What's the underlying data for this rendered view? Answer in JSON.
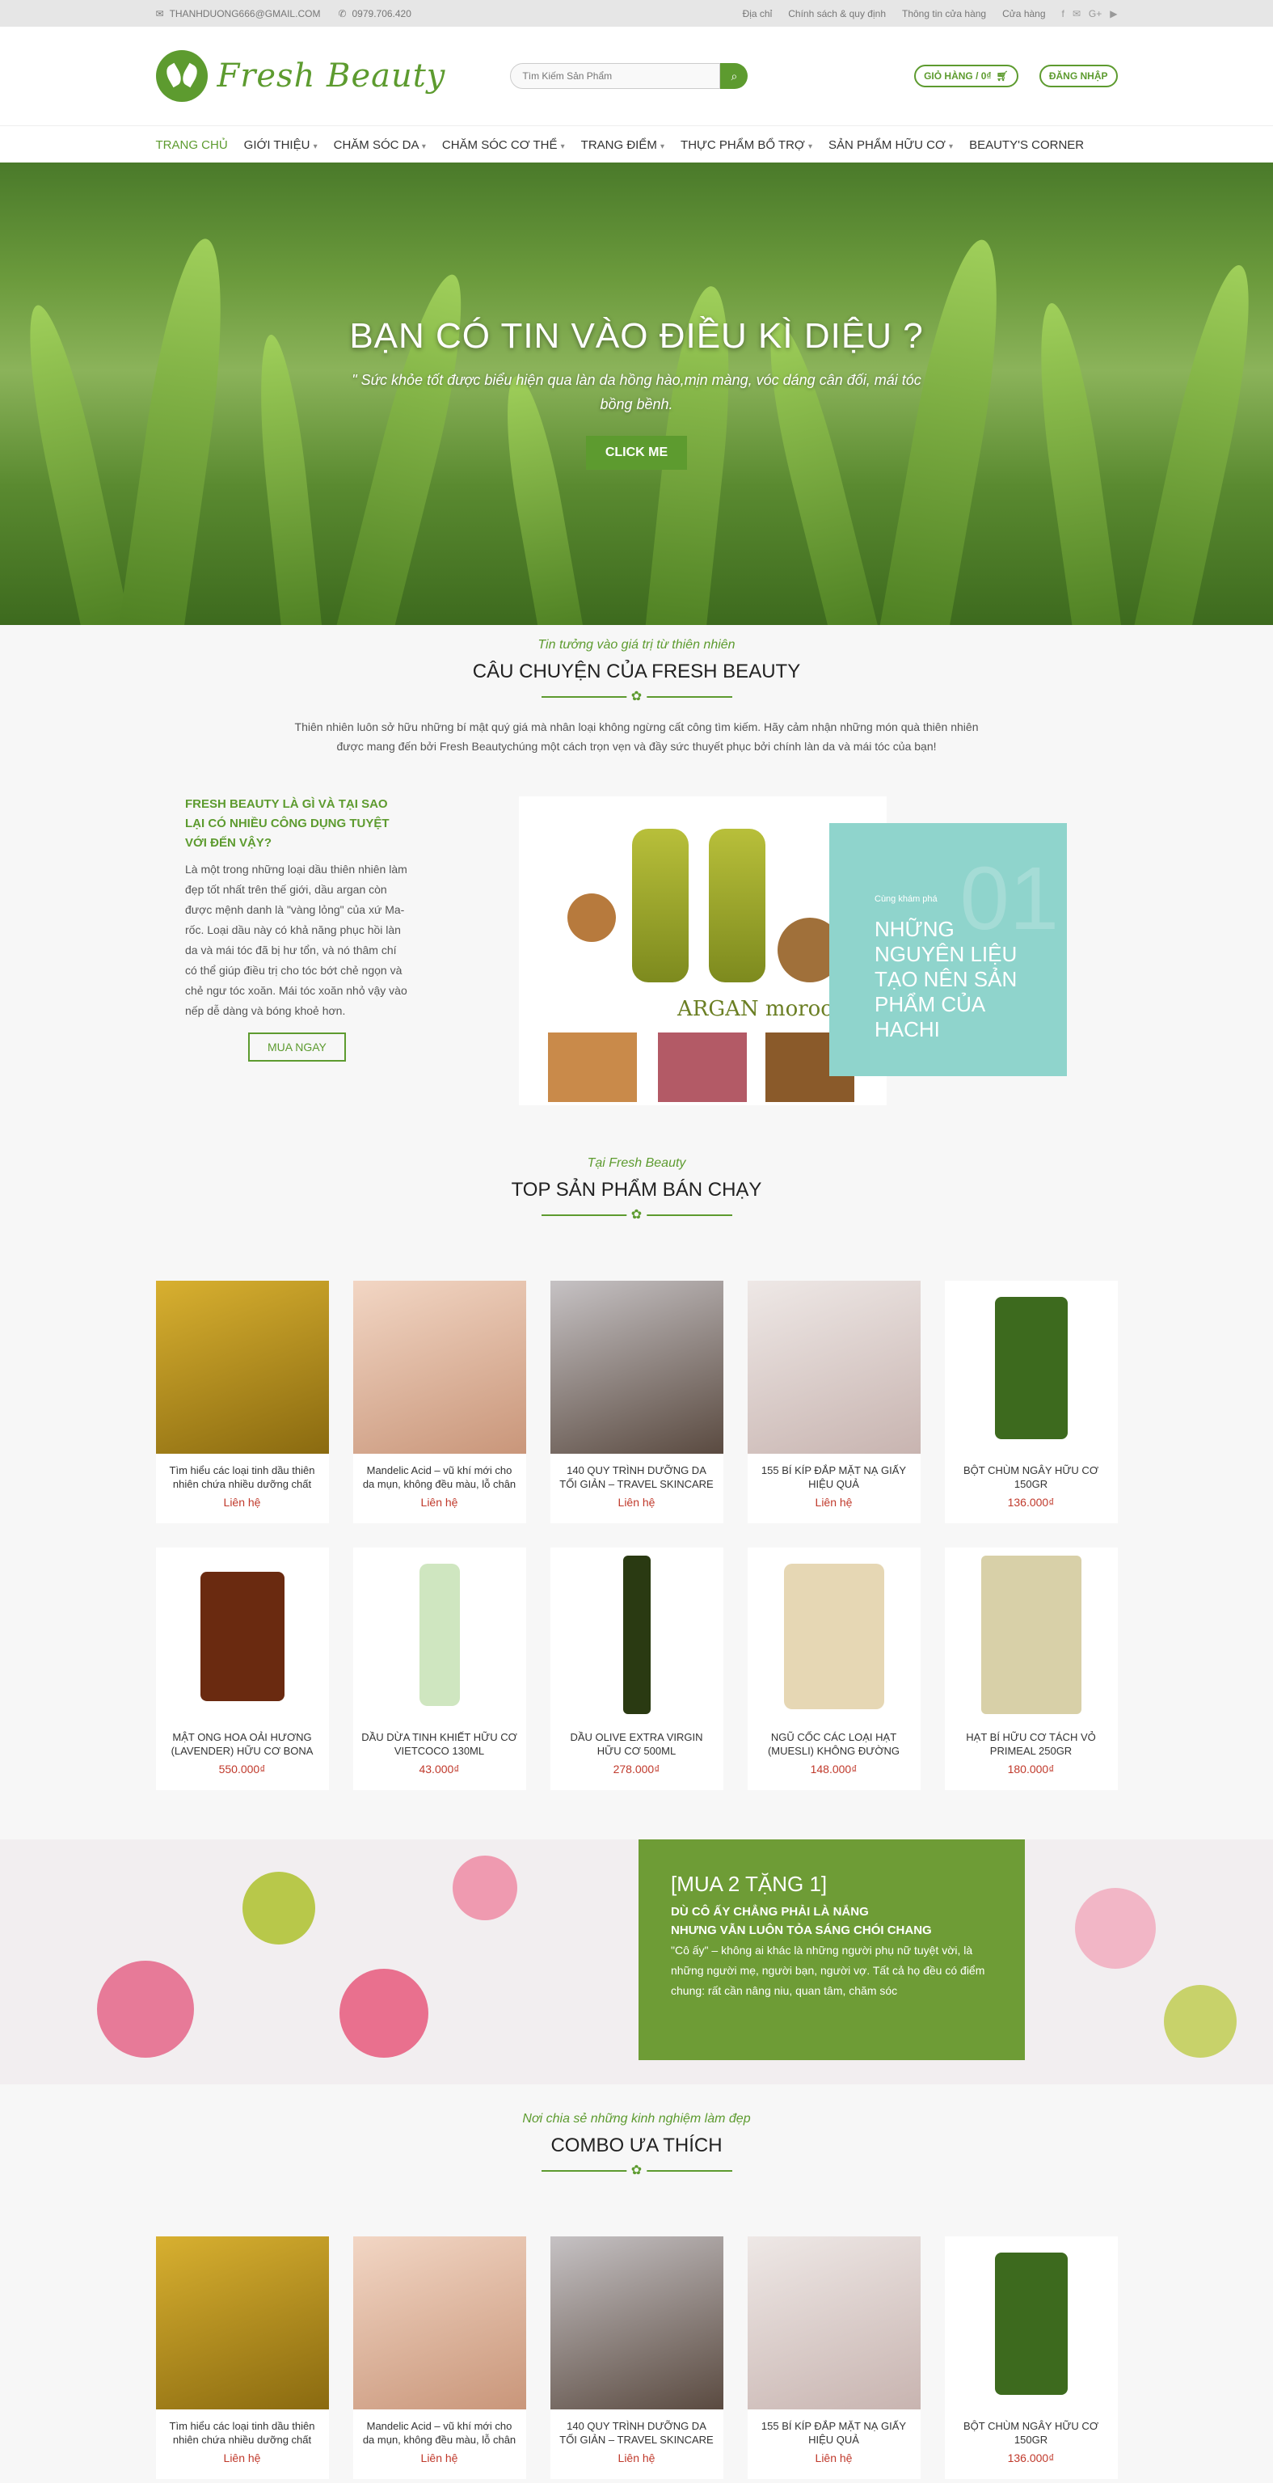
{
  "topbar": {
    "email": "THANHDUONG666@GMAIL.COM",
    "phone": "0979.706.420",
    "links": [
      "Địa chỉ",
      "Chính sách & quy định",
      "Thông tin cửa hàng",
      "Cửa hàng"
    ]
  },
  "header": {
    "logo_text": "Fresh Beauty",
    "search_placeholder": "Tìm Kiếm Sản Phẩm",
    "cart_label": "GIỎ HÀNG / 0₫",
    "login_label": "ĐĂNG NHẬP"
  },
  "nav": {
    "items": [
      "TRANG CHỦ",
      "GIỚI THIỆU",
      "CHĂM SÓC DA",
      "CHĂM SÓC CƠ THỂ",
      "TRANG ĐIỂM",
      "THỰC PHẨM BỔ TRỢ",
      "SẢN PHẨM HỮU CƠ",
      "BEAUTY'S CORNER"
    ]
  },
  "hero": {
    "title": "BẠN CÓ TIN VÀO ĐIỀU KÌ DIỆU ?",
    "quote": "\" Sức khỏe tốt được biểu hiện qua làn da hồng hào,mịn màng, vóc dáng cân đối, mái tóc bồng bềnh.",
    "button": "CLICK ME"
  },
  "story": {
    "subtitle": "Tin tưởng vào giá trị từ thiên nhiên",
    "title": "CÂU CHUYỆN CỦA FRESH BEAUTY",
    "text": "Thiên nhiên luôn sở hữu những bí mật quý giá mà nhân loại không ngừng cất công tìm kiếm. Hãy cảm nhận những món quà thiên nhiên được mang đến bởi Fresh Beautychúng một cách trọn vẹn và đầy sức thuyết phục bởi chính làn da và mái tóc của bạn!",
    "left_heading": "FRESH BEAUTY LÀ GÌ VÀ TẠI SAO LẠI CÓ NHIỀU CÔNG DỤNG TUYỆT VỚI ĐẾN VẬY?",
    "left_text": "Là một trong những loại dầu thiên nhiên làm đẹp tốt nhất trên thế giới, dầu argan còn được mệnh danh là \"vàng lỏng\" của xứ Ma-rốc. Loại dầu này có khả năng phục hồi làn da và mái tóc đã bị hư tổn, và nó thâm chí có thể giúp điều trị cho tóc bớt chẻ ngọn và chẻ ngư tóc xoăn. Mái tóc xoăn nhỏ vậy vào nếp dễ dàng và bóng khoẻ hơn.",
    "button": "MUA NGAY",
    "image_text": "ARGAN morocco",
    "teal_small": "Cùng khám phá",
    "teal_title": "NHỮNG NGUYÊN LIỆU TẠO NÊN SẢN PHẨM CỦA HACHI",
    "teal_number": "01"
  },
  "top_products": {
    "subtitle": "Tại Fresh Beauty",
    "title": "TOP SẢN PHẨM BÁN CHẠY",
    "items": [
      {
        "name": "Tìm hiểu các loại tinh dầu thiên nhiên chứa nhiều dưỡng chất",
        "price": "Liên hệ"
      },
      {
        "name": "Mandelic Acid – vũ khí mới cho da mụn, không đều màu, lỗ chân",
        "price": "Liên hệ"
      },
      {
        "name": "140 QUY TRÌNH DƯỠNG DA TỐI GIẢN – TRAVEL SKINCARE",
        "price": "Liên hệ"
      },
      {
        "name": "155 BÍ KÍP ĐẮP MẶT NẠ GIẤY HIỆU QUẢ",
        "price": "Liên hệ"
      },
      {
        "name": "BỘT CHÙM NGÂY HỮU CƠ 150GR",
        "price": "136.000₫"
      },
      {
        "name": "MẬT ONG HOA OẢI HƯƠNG (LAVENDER) HỮU CƠ BONA",
        "price": "550.000₫"
      },
      {
        "name": "DẦU DỪA TINH KHIẾT HỮU CƠ VIETCOCO 130ML",
        "price": "43.000₫"
      },
      {
        "name": "DẦU OLIVE EXTRA VIRGIN HỮU CƠ 500ML",
        "price": "278.000₫"
      },
      {
        "name": "NGŨ CỐC CÁC LOẠI HẠT (MUESLI) KHÔNG ĐƯỜNG",
        "price": "148.000₫"
      },
      {
        "name": "HẠT BÍ HỮU CƠ TÁCH VỎ PRIMEAL 250GR",
        "price": "180.000₫"
      }
    ]
  },
  "promo": {
    "title": "[MUA 2 TẶNG 1]",
    "line2": "DÙ CÔ ẤY CHẲNG PHẢI LÀ NẮNG",
    "line3": "NHƯNG VẪN LUÔN TỎA SÁNG CHÓI CHANG",
    "text": "\"Cô ấy\" – không ai khác là những người phụ nữ tuyệt vời, là những người mẹ, người bạn, người vợ. Tất cả họ đều có điểm chung: rất cần nâng niu, quan tâm, chăm sóc"
  },
  "combo": {
    "subtitle": "Nơi chia sẻ những kinh nghiệm làm đẹp",
    "title": "COMBO ƯA THÍCH",
    "items": [
      {
        "name": "Tìm hiểu các loại tinh dầu thiên nhiên chứa nhiều dưỡng chất",
        "price": "Liên hệ"
      },
      {
        "name": "Mandelic Acid – vũ khí mới cho da mụn, không đều màu, lỗ chân",
        "price": "Liên hệ"
      },
      {
        "name": "140 QUY TRÌNH DƯỠNG DA TỐI GIẢN – TRAVEL SKINCARE",
        "price": "Liên hệ"
      },
      {
        "name": "155 BÍ KÍP ĐẮP MẶT NẠ GIẤY HIỆU QUẢ",
        "price": "Liên hệ"
      },
      {
        "name": "BỘT CHÙM NGÂY HỮU CƠ 150GR",
        "price": "136.000₫"
      }
    ]
  },
  "colors": {
    "brand": "#5d9b2f",
    "price": "#c0392b",
    "teal": "#8fd4cc"
  }
}
